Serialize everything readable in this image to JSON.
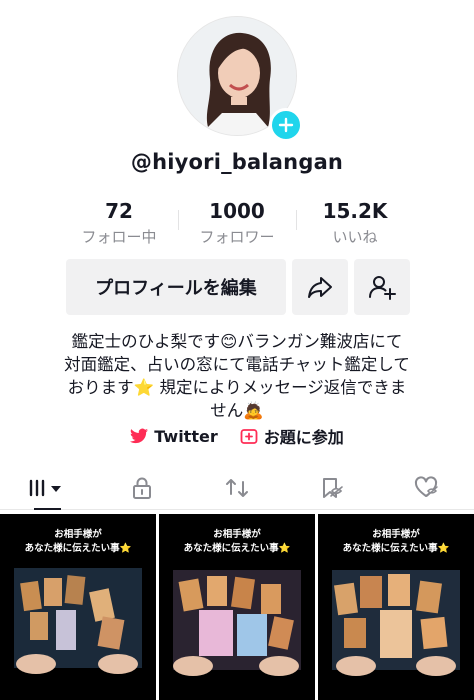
{
  "profile": {
    "username": "@hiyori_balangan"
  },
  "stats": [
    {
      "value": "72",
      "label": "フォロー中"
    },
    {
      "value": "1000",
      "label": "フォロワー"
    },
    {
      "value": "15.2K",
      "label": "いいね"
    }
  ],
  "actions": {
    "edit_profile": "プロフィールを編集"
  },
  "bio": {
    "line1": "鑑定士のひよ梨です😊バランガン難波店にて",
    "line2": "対面鑑定、占いの窓にて電話チャット鑑定して",
    "line3": "おります⭐ 規定によりメッセージ返信できま",
    "line4": "せん🙇"
  },
  "links": {
    "twitter": "Twitter",
    "topic": "お題に参加"
  },
  "videos": [
    {
      "caption1": "お相手様が",
      "caption2": "あなた様に伝えたい事⭐"
    },
    {
      "caption1": "お相手様が",
      "caption2": "あなた様に伝えたい事⭐"
    },
    {
      "caption1": "お相手様が",
      "caption2": "あなた様に伝えたい事⭐"
    }
  ],
  "colors": {
    "accent_badge": "#20d5ec",
    "twitter_pink": "#fe2c55"
  }
}
